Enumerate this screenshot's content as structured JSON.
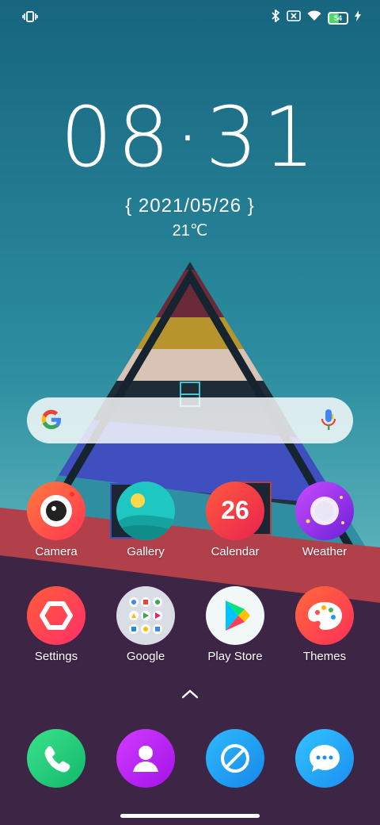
{
  "status_bar": {
    "battery_level": "54",
    "icons": [
      "vibrate-icon",
      "bluetooth-icon",
      "no-sim-icon",
      "wifi-icon",
      "battery-icon",
      "charging-icon"
    ]
  },
  "lock": {
    "time": "08·31",
    "date": "{ 2021/05/26 }",
    "temperature": "21℃"
  },
  "search": {
    "icons": [
      "google-g-icon",
      "microphone-icon"
    ]
  },
  "apps_row1": [
    {
      "label": "Camera"
    },
    {
      "label": "Gallery"
    },
    {
      "label": "Calendar",
      "icon_text": "26"
    },
    {
      "label": "Weather"
    }
  ],
  "apps_row2": [
    {
      "label": "Settings"
    },
    {
      "label": "Google"
    },
    {
      "label": "Play Store"
    },
    {
      "label": "Themes"
    }
  ],
  "dock": [
    "phone-icon",
    "contacts-icon",
    "browser-icon",
    "messages-icon"
  ],
  "colors": {
    "sky_top": "#1d6f88",
    "sky_bottom": "#5bb5bd",
    "floor": "#3d2545",
    "camera": "#ff5a45",
    "calendar": "#f03c4c",
    "weather": "#9b2ee0",
    "settings": "#ff4d5a",
    "phone": "#2ed37a",
    "contacts": "#b521f0",
    "browser": "#1fa3f0",
    "messages": "#22a5f0"
  }
}
